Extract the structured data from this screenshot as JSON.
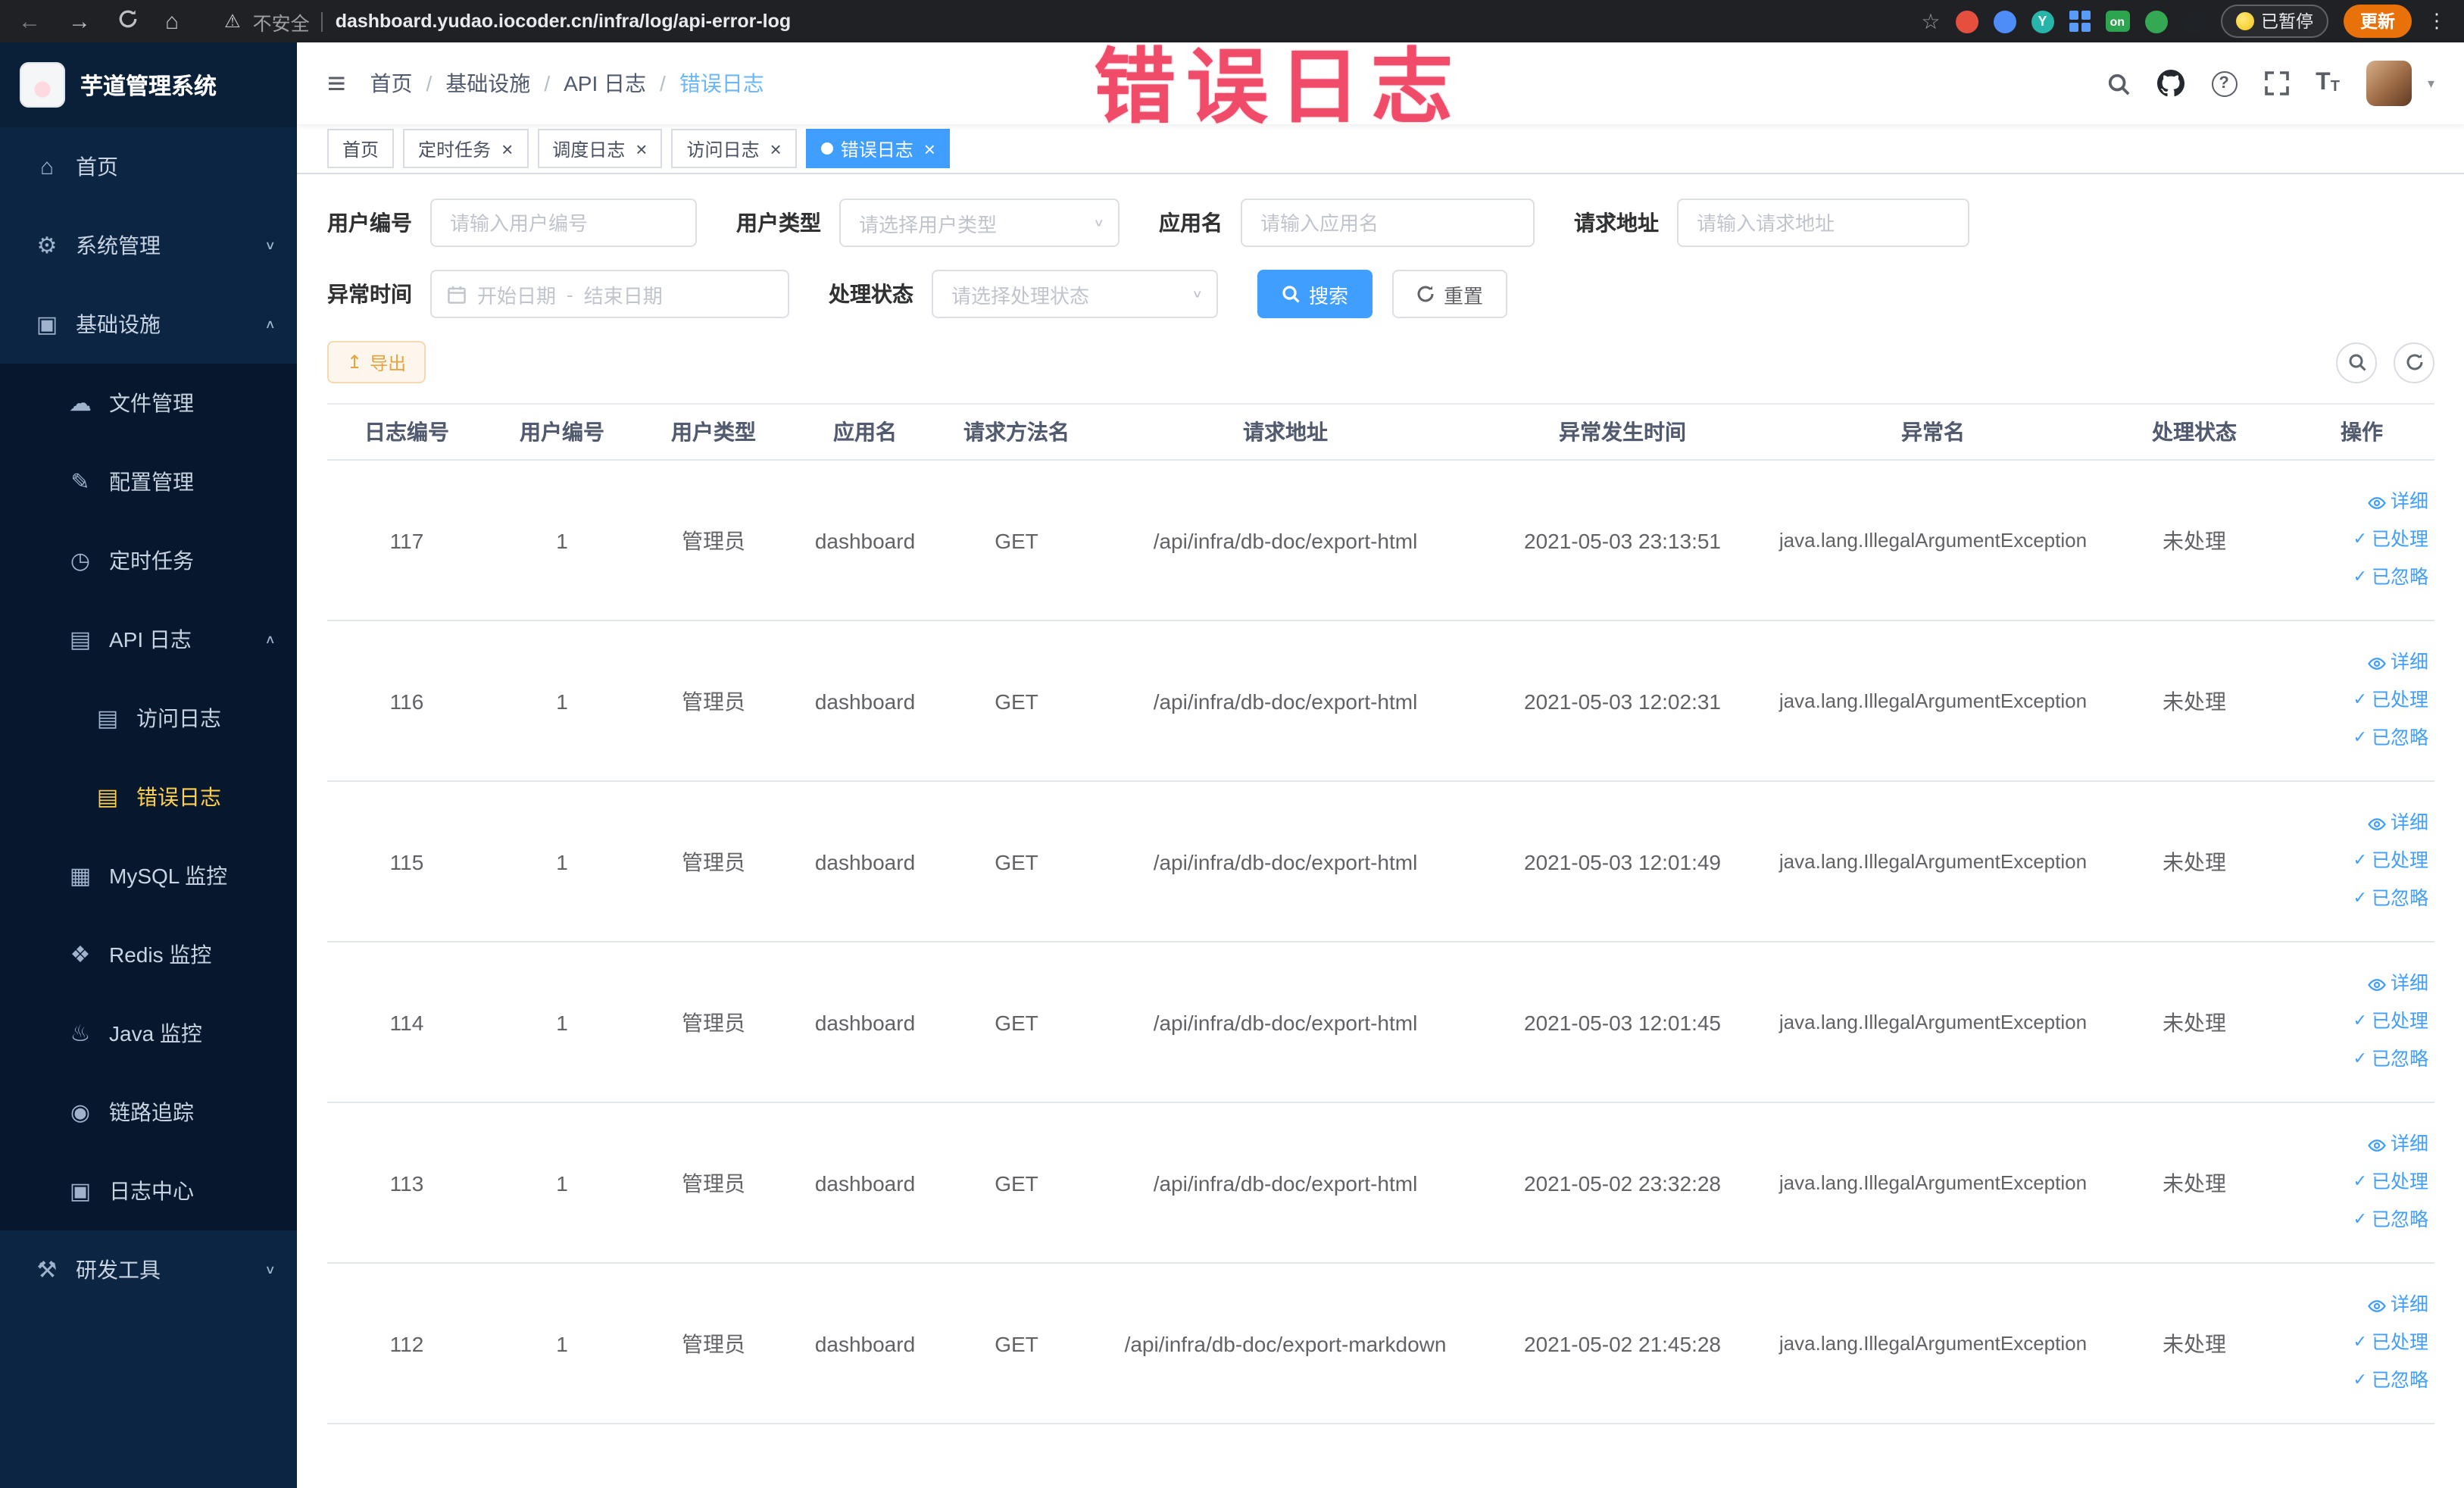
{
  "chrome": {
    "security_label": "不安全",
    "url": "dashboard.yudao.iocoder.cn/infra/log/api-error-log",
    "ext_y": "Y",
    "ext_on": "on",
    "paused_label": "已暂停",
    "update_label": "更新"
  },
  "annotation": "错误日志",
  "sidebar": {
    "title": "芋道管理系统",
    "items": [
      {
        "key": "home",
        "label": "首页",
        "icon": "home-icon",
        "level": 0
      },
      {
        "key": "system-mgmt",
        "label": "系统管理",
        "icon": "gear-icon",
        "level": 0,
        "arrow": "down"
      },
      {
        "key": "infrastructure",
        "label": "基础设施",
        "icon": "monitor-icon",
        "level": 0,
        "arrow": "up"
      },
      {
        "key": "file-mgmt",
        "label": "文件管理",
        "icon": "cloud-icon",
        "level": 1
      },
      {
        "key": "config-mgmt",
        "label": "配置管理",
        "icon": "edit-icon",
        "level": 1
      },
      {
        "key": "scheduled-jobs",
        "label": "定时任务",
        "icon": "timer-icon",
        "level": 1
      },
      {
        "key": "api-logs",
        "label": "API 日志",
        "icon": "api-doc-icon",
        "level": 1,
        "arrow": "up"
      },
      {
        "key": "access-log",
        "label": "访问日志",
        "icon": "doc-icon",
        "level": 2
      },
      {
        "key": "error-log",
        "label": "错误日志",
        "icon": "doc-icon",
        "level": 2,
        "active": true
      },
      {
        "key": "mysql-monitor",
        "label": "MySQL 监控",
        "icon": "database-icon",
        "level": 1
      },
      {
        "key": "redis-monitor",
        "label": "Redis 监控",
        "icon": "redis-icon",
        "level": 1
      },
      {
        "key": "java-monitor",
        "label": "Java 监控",
        "icon": "java-icon",
        "level": 1
      },
      {
        "key": "tracing",
        "label": "链路追踪",
        "icon": "eye-icon",
        "level": 1
      },
      {
        "key": "log-center",
        "label": "日志中心",
        "icon": "log-icon",
        "level": 1
      },
      {
        "key": "dev-tools",
        "label": "研发工具",
        "icon": "tools-icon",
        "level": 0,
        "arrow": "down"
      }
    ]
  },
  "header": {
    "breadcrumbs": [
      "首页",
      "基础设施",
      "API 日志",
      "错误日志"
    ]
  },
  "tabs": [
    {
      "key": "home",
      "label": "首页",
      "closable": false,
      "active": false
    },
    {
      "key": "scheduled-jobs",
      "label": "定时任务",
      "closable": true,
      "active": false
    },
    {
      "key": "schedule-log",
      "label": "调度日志",
      "closable": true,
      "active": false
    },
    {
      "key": "access-log",
      "label": "访问日志",
      "closable": true,
      "active": false
    },
    {
      "key": "error-log",
      "label": "错误日志",
      "closable": true,
      "active": true
    }
  ],
  "filters": {
    "user_id": {
      "label": "用户编号",
      "placeholder": "请输入用户编号"
    },
    "user_type": {
      "label": "用户类型",
      "placeholder": "请选择用户类型"
    },
    "app_name": {
      "label": "应用名",
      "placeholder": "请输入应用名"
    },
    "request_url": {
      "label": "请求地址",
      "placeholder": "请输入请求地址"
    },
    "exception_time": {
      "label": "异常时间",
      "start_placeholder": "开始日期",
      "separator": "-",
      "end_placeholder": "结束日期"
    },
    "process_status": {
      "label": "处理状态",
      "placeholder": "请选择处理状态"
    },
    "search_label": "搜索",
    "reset_label": "重置"
  },
  "toolbar": {
    "export_label": "导出"
  },
  "table": {
    "columns": [
      "日志编号",
      "用户编号",
      "用户类型",
      "应用名",
      "请求方法名",
      "请求地址",
      "异常发生时间",
      "异常名",
      "处理状态",
      "操作"
    ],
    "actions": [
      "详细",
      "已处理",
      "已忽略"
    ],
    "rows": [
      {
        "id": "117",
        "user_id": "1",
        "user_type": "管理员",
        "app": "dashboard",
        "method": "GET",
        "url": "/api/infra/db-doc/export-html",
        "time": "2021-05-03 23:13:51",
        "exception": "java.lang.IllegalArgumentException",
        "status": "未处理"
      },
      {
        "id": "116",
        "user_id": "1",
        "user_type": "管理员",
        "app": "dashboard",
        "method": "GET",
        "url": "/api/infra/db-doc/export-html",
        "time": "2021-05-03 12:02:31",
        "exception": "java.lang.IllegalArgumentException",
        "status": "未处理"
      },
      {
        "id": "115",
        "user_id": "1",
        "user_type": "管理员",
        "app": "dashboard",
        "method": "GET",
        "url": "/api/infra/db-doc/export-html",
        "time": "2021-05-03 12:01:49",
        "exception": "java.lang.IllegalArgumentException",
        "status": "未处理"
      },
      {
        "id": "114",
        "user_id": "1",
        "user_type": "管理员",
        "app": "dashboard",
        "method": "GET",
        "url": "/api/infra/db-doc/export-html",
        "time": "2021-05-03 12:01:45",
        "exception": "java.lang.IllegalArgumentException",
        "status": "未处理"
      },
      {
        "id": "113",
        "user_id": "1",
        "user_type": "管理员",
        "app": "dashboard",
        "method": "GET",
        "url": "/api/infra/db-doc/export-html",
        "time": "2021-05-02 23:32:28",
        "exception": "java.lang.IllegalArgumentException",
        "status": "未处理"
      },
      {
        "id": "112",
        "user_id": "1",
        "user_type": "管理员",
        "app": "dashboard",
        "method": "GET",
        "url": "/api/infra/db-doc/export-markdown",
        "time": "2021-05-02 21:45:28",
        "exception": "java.lang.IllegalArgumentException",
        "status": "未处理"
      }
    ]
  }
}
